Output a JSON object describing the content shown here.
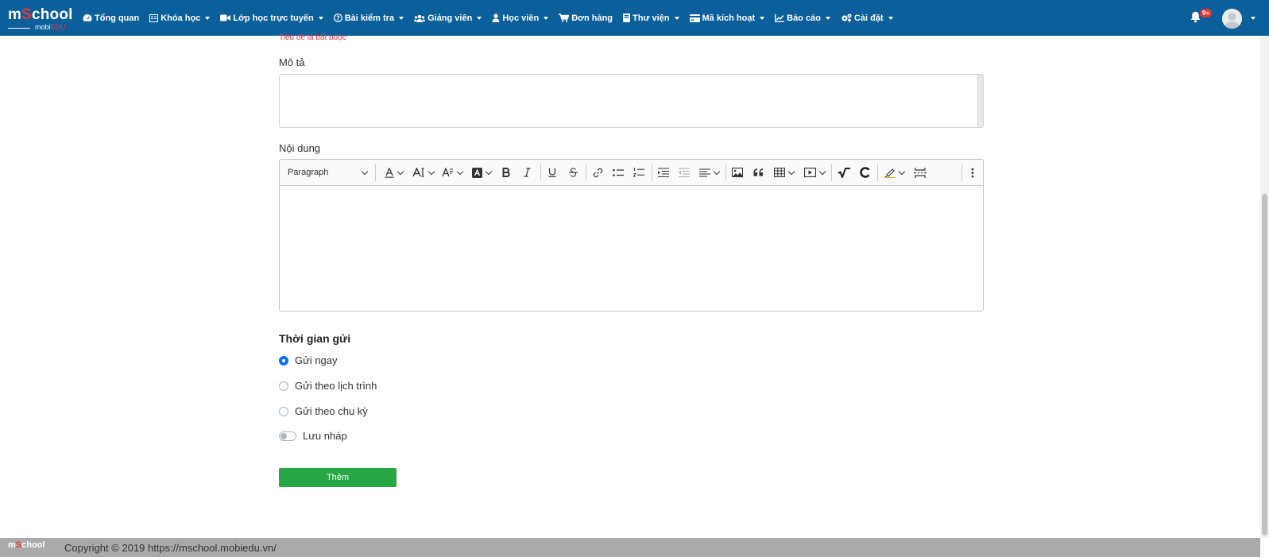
{
  "brand": {
    "logo_main_pre": "m",
    "logo_main_o": "S",
    "logo_main_post": "chool",
    "logo_sub_pre": "mobi",
    "logo_sub_edu": "EDU"
  },
  "nav": {
    "items": [
      {
        "label": "Tổng quan",
        "icon": "dashboard-icon",
        "dropdown": false
      },
      {
        "label": "Khóa học",
        "icon": "book-icon",
        "dropdown": true
      },
      {
        "label": "Lớp học trực tuyến",
        "icon": "video-icon",
        "dropdown": true
      },
      {
        "label": "Bài kiểm tra",
        "icon": "question-icon",
        "dropdown": true
      },
      {
        "label": "Giảng viên",
        "icon": "users-icon",
        "dropdown": true
      },
      {
        "label": "Học viên",
        "icon": "user-icon",
        "dropdown": true
      },
      {
        "label": "Đơn hàng",
        "icon": "cart-icon",
        "dropdown": false
      },
      {
        "label": "Thư viện",
        "icon": "library-icon",
        "dropdown": true
      },
      {
        "label": "Mã kích hoạt",
        "icon": "card-icon",
        "dropdown": true
      },
      {
        "label": "Báo cáo",
        "icon": "chart-icon",
        "dropdown": true
      },
      {
        "label": "Cài đặt",
        "icon": "gears-icon",
        "dropdown": true
      }
    ],
    "notification_badge": "9+"
  },
  "form": {
    "title_error": "Tiêu đề là bắt buộc",
    "description_label": "Mô tả",
    "description_value": "",
    "content_label": "Nội dung",
    "editor": {
      "paragraph_select": "Paragraph"
    },
    "send_time_title": "Thời gian gửi",
    "options": [
      {
        "label": "Gửi ngay",
        "checked": true
      },
      {
        "label": "Gửi theo lịch trình",
        "checked": false
      },
      {
        "label": "Gửi theo chu kỳ",
        "checked": false
      }
    ],
    "draft_label": "Lưu nháp",
    "draft_on": false,
    "submit_label": "Thêm"
  },
  "footer": {
    "logo_pre": "m",
    "logo_o": "S",
    "logo_post": "chool",
    "copyright": "Copyright © 2019 https://mschool.mobiedu.vn/"
  },
  "colors": {
    "topbar": "#0b5f9a",
    "accent_red": "#e53935",
    "primary": "#0d6efd",
    "success": "#28a745",
    "error": "#dc3545"
  }
}
